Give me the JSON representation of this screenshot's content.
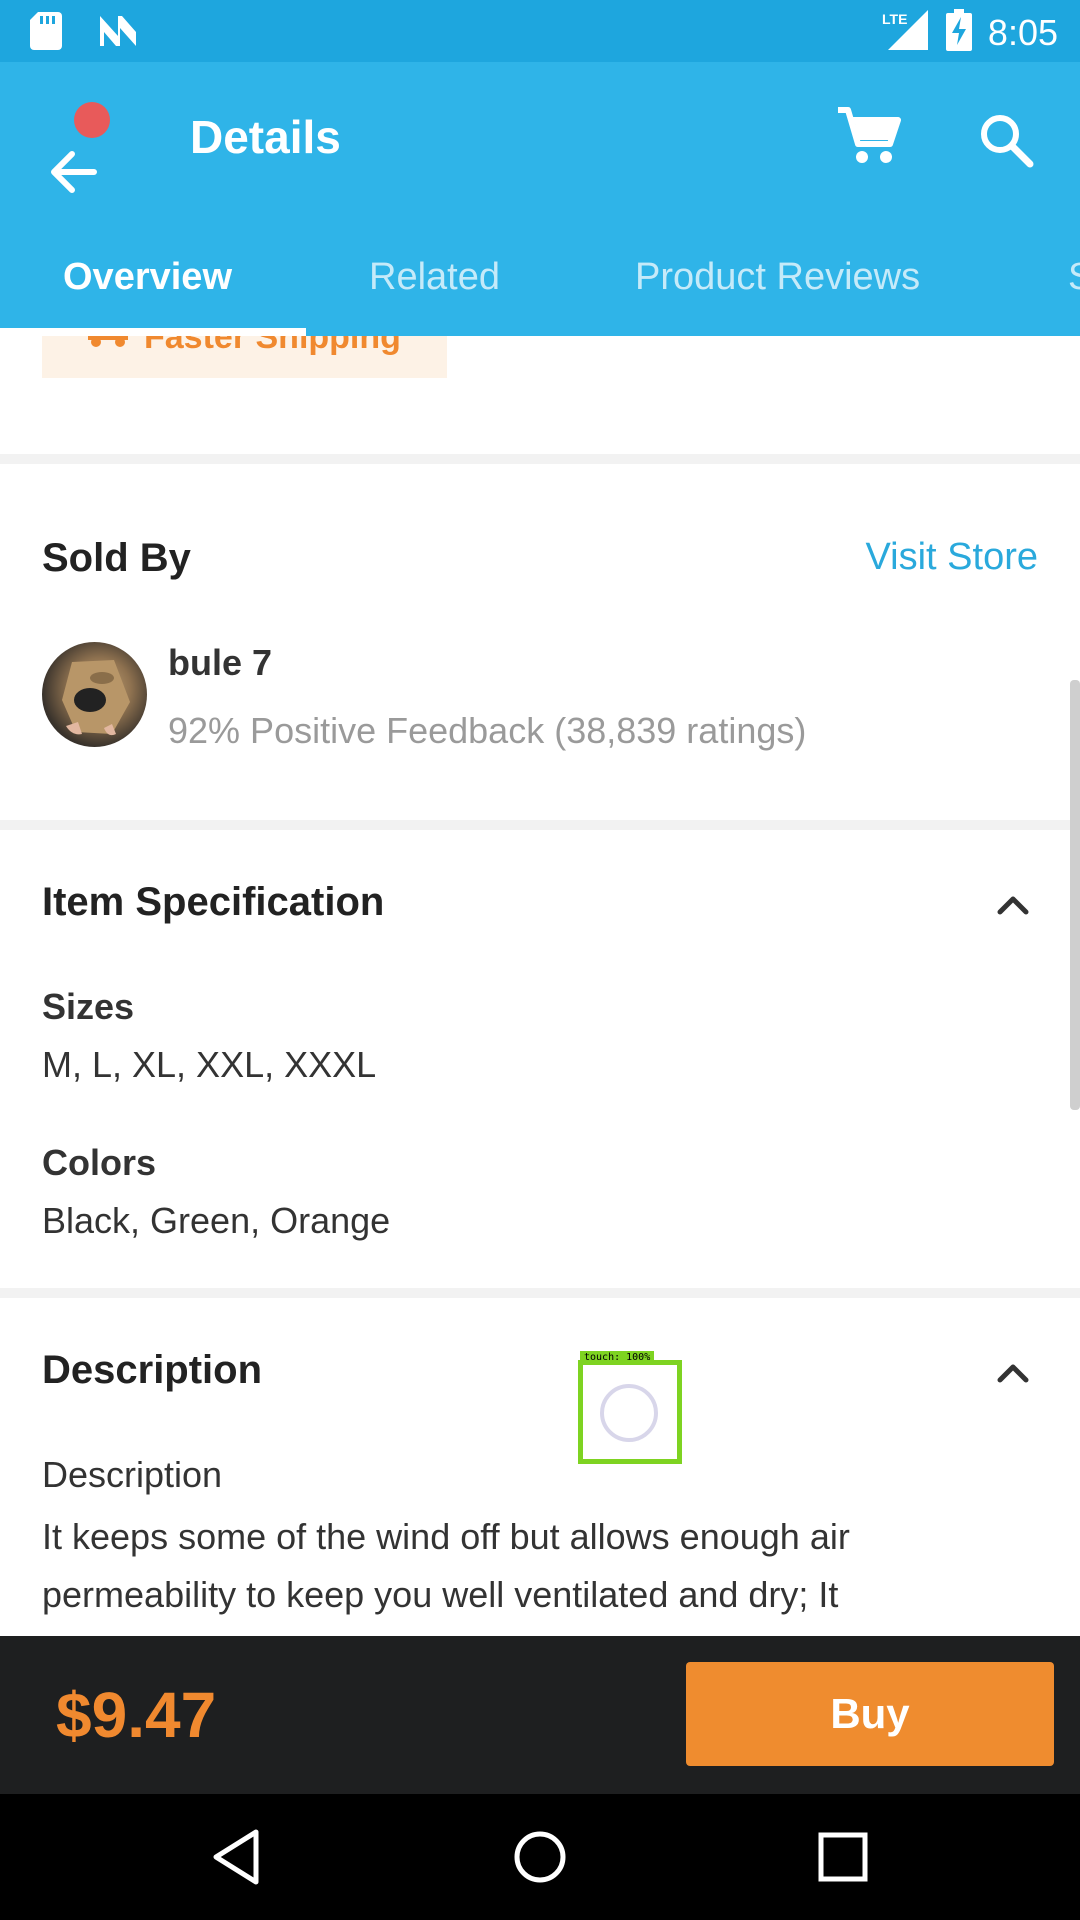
{
  "status_bar": {
    "time": "8:05",
    "network": "LTE",
    "icons": [
      "sd-card-icon",
      "n-notification-icon",
      "signal-icon",
      "battery-charging-icon"
    ]
  },
  "app_bar": {
    "title": "Details",
    "icons": [
      "back-arrow-icon",
      "cart-icon",
      "search-icon"
    ]
  },
  "tabs": [
    {
      "label": "Overview",
      "active": true
    },
    {
      "label": "Related",
      "active": false
    },
    {
      "label": "Product Reviews",
      "active": false
    },
    {
      "label": "S",
      "active": false
    }
  ],
  "shipping": {
    "label": "Faster Shipping"
  },
  "seller": {
    "section_title": "Sold By",
    "visit_store": "Visit Store",
    "name": "bule 7",
    "feedback": "92% Positive Feedback (38,839 ratings)"
  },
  "specification": {
    "title": "Item Specification",
    "items": [
      {
        "label": "Sizes",
        "value": "M, L, XL, XXL, XXXL"
      },
      {
        "label": "Colors",
        "value": "Black, Green, Orange"
      }
    ]
  },
  "description": {
    "title": "Description",
    "heading": "Description",
    "body": "It keeps some of the wind off but allows enough air permeability to keep you well ventilated and dry; It"
  },
  "touch_indicator": {
    "label": "touch: 100%"
  },
  "purchase": {
    "price": "$9.47",
    "buy_label": "Buy"
  },
  "colors": {
    "accent": "#2fb4e8",
    "status_bar": "#1ea6de",
    "price": "#f0892f",
    "buy_button": "#ef8c2f",
    "link": "#2aa9dc"
  }
}
